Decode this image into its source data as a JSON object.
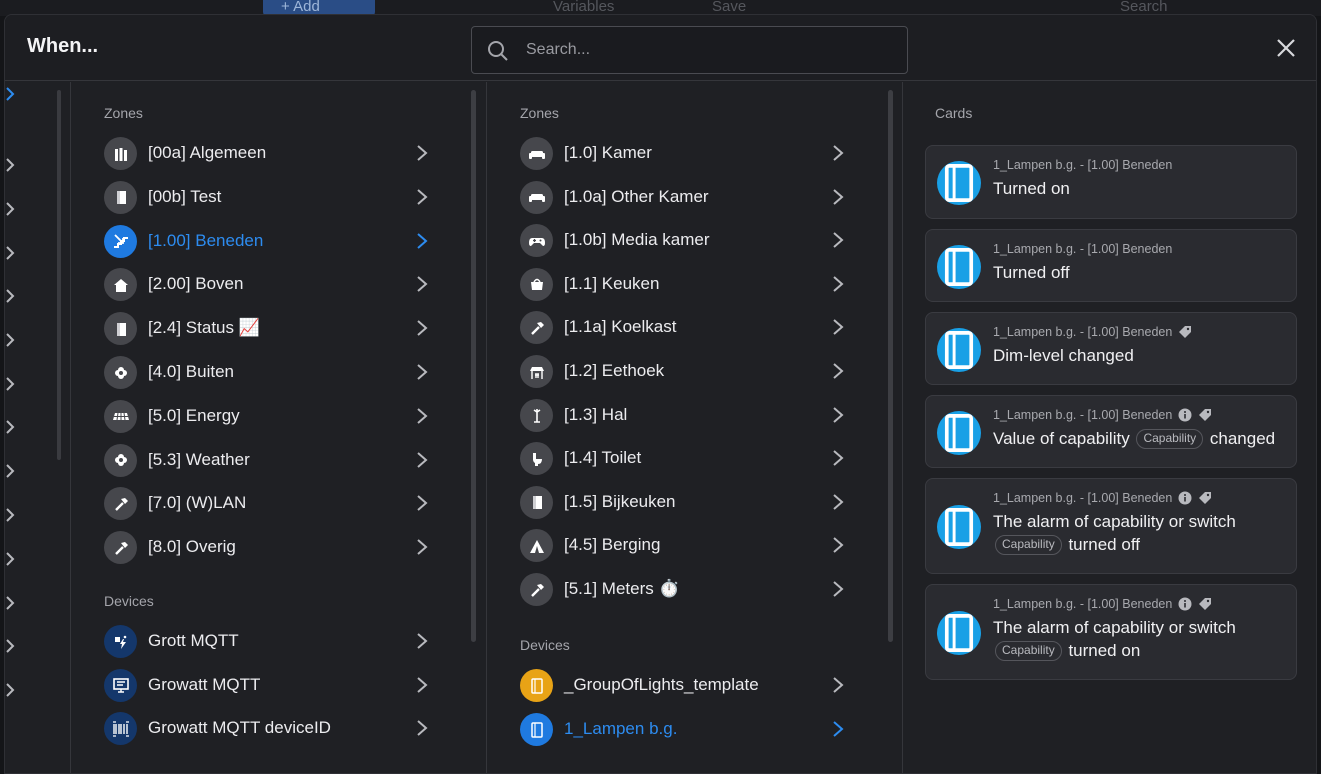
{
  "background": {
    "add_label": "+ Add",
    "variables_label": "Variables",
    "save_label": "Save",
    "search_label": "Search"
  },
  "modal": {
    "title": "When...",
    "search_placeholder": "Search..."
  },
  "column1": {
    "zones_label": "Zones",
    "zones": [
      {
        "label": "[00a] Algemeen",
        "icon": "books-icon"
      },
      {
        "label": "[00b] Test",
        "icon": "door-icon"
      },
      {
        "label": "[1.00] Beneden",
        "icon": "stairs-down-icon",
        "active": true
      },
      {
        "label": "[2.00] Boven",
        "icon": "house-icon"
      },
      {
        "label": "[2.4] Status 📈",
        "icon": "door-icon"
      },
      {
        "label": "[4.0] Buiten",
        "icon": "flower-icon"
      },
      {
        "label": "[5.0] Energy",
        "icon": "solar-panel-icon"
      },
      {
        "label": "[5.3] Weather",
        "icon": "flower-icon"
      },
      {
        "label": "[7.0] (W)LAN",
        "icon": "hammer-icon"
      },
      {
        "label": "[8.0] Overig",
        "icon": "hammer-icon"
      }
    ],
    "devices_label": "Devices",
    "devices": [
      {
        "label": "Grott MQTT",
        "icon": "flash-icon"
      },
      {
        "label": "Growatt MQTT",
        "icon": "presentation-icon"
      },
      {
        "label": "Growatt MQTT deviceID",
        "icon": "barcode-icon"
      }
    ]
  },
  "column2": {
    "zones_label": "Zones",
    "zones": [
      {
        "label": "[1.0] Kamer",
        "icon": "sofa-icon"
      },
      {
        "label": "[1.0a] Other Kamer",
        "icon": "sofa-icon"
      },
      {
        "label": "[1.0b] Media kamer",
        "icon": "gamepad-icon"
      },
      {
        "label": "[1.1] Keuken",
        "icon": "cooking-pot-icon"
      },
      {
        "label": "[1.1a] Koelkast",
        "icon": "hammer-icon"
      },
      {
        "label": "[1.2] Eethoek",
        "icon": "dining-table-icon"
      },
      {
        "label": "[1.3] Hal",
        "icon": "coat-rack-icon"
      },
      {
        "label": "[1.4] Toilet",
        "icon": "toilet-icon"
      },
      {
        "label": "[1.5] Bijkeuken",
        "icon": "door-icon"
      },
      {
        "label": "[4.5] Berging",
        "icon": "tent-icon"
      },
      {
        "label": "[5.1] Meters ⏱️",
        "icon": "hammer-icon"
      }
    ],
    "devices_label": "Devices",
    "devices": [
      {
        "label": "_GroupOfLights_template",
        "icon": "light-panel-icon",
        "color": "#e8a316"
      },
      {
        "label": "1_Lampen b.g.",
        "icon": "light-panel-icon",
        "color": "#1f7ae0",
        "active": true
      }
    ]
  },
  "column3": {
    "cards_label": "Cards",
    "cards": [
      {
        "subtitle": "1_Lampen b.g. - [1.00] Beneden",
        "text": "Turned on",
        "info": false,
        "tag": false
      },
      {
        "subtitle": "1_Lampen b.g. - [1.00] Beneden",
        "text": "Turned off",
        "info": false,
        "tag": false
      },
      {
        "subtitle": "1_Lampen b.g. - [1.00] Beneden",
        "text": "Dim-level changed",
        "info": false,
        "tag": true
      },
      {
        "subtitle": "1_Lampen b.g. - [1.00] Beneden",
        "text_before": "Value of capability",
        "pill": "Capability",
        "text_after": "changed",
        "info": true,
        "tag": true
      },
      {
        "subtitle": "1_Lampen b.g. - [1.00] Beneden",
        "text_line1": "The alarm of capability or switch",
        "pill": "Capability",
        "text_after": "turned off",
        "info": true,
        "tag": true
      },
      {
        "subtitle": "1_Lampen b.g. - [1.00] Beneden",
        "text_line1": "The alarm of capability or switch",
        "pill": "Capability",
        "text_after": "turned on",
        "info": true,
        "tag": true
      }
    ]
  },
  "colors": {
    "accent": "#2d8cf0",
    "card_icon": "#19a0e6",
    "device_icon_bg": "#14376b"
  }
}
